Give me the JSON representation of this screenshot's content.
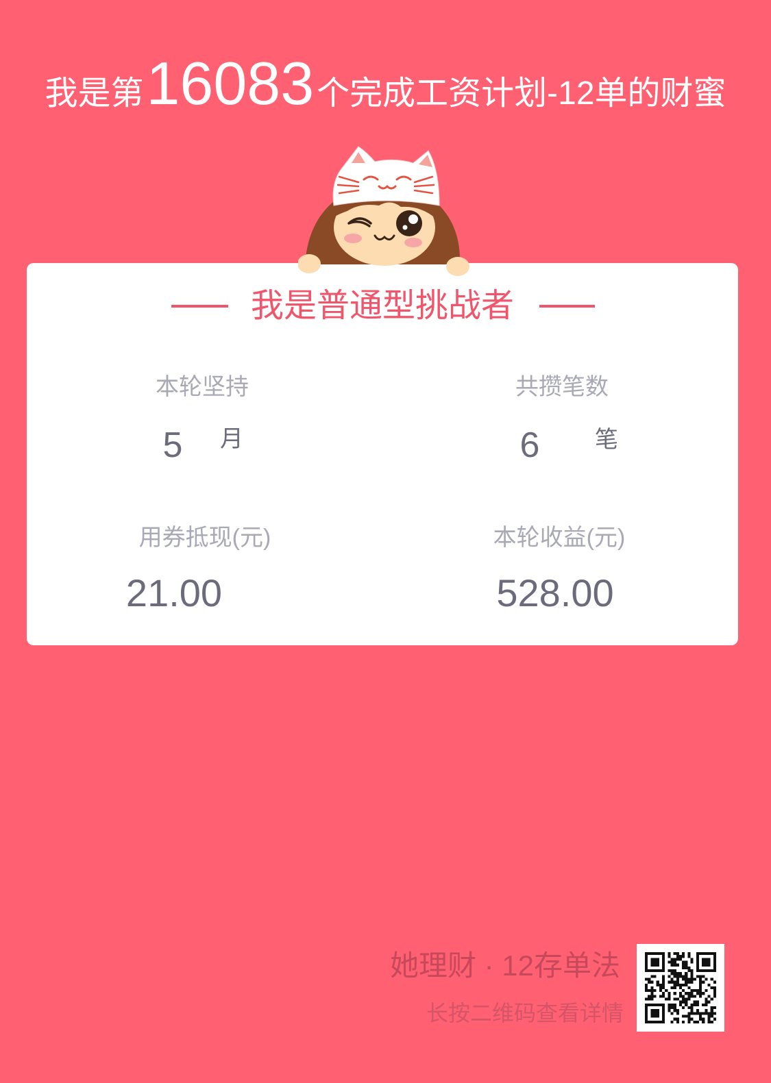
{
  "header": {
    "prefix": "我是第",
    "rank": "16083",
    "suffix": "个完成工资计划-12单的财蜜"
  },
  "card": {
    "title": "我是普通型挑战者",
    "stats": [
      {
        "label": "本轮坚持",
        "value": "5",
        "unit": "月"
      },
      {
        "label": "共攒笔数",
        "value": "6",
        "unit": "笔"
      },
      {
        "label": "用券抵现(元)",
        "value": "21.00"
      },
      {
        "label": "本轮收益(元)",
        "value": "528.00"
      }
    ]
  },
  "footer": {
    "brand": "她理财 · 12存单法",
    "hint": "长按二维码查看详情"
  },
  "icons": {
    "mascot": "cat-hat-girl-mascot-icon",
    "qr": "qr-code-icon"
  },
  "colors": {
    "background": "#FF6173",
    "card": "#FFFFFF",
    "accent": "#F0566B",
    "label": "#A9A9B5",
    "value": "#6B6B7B",
    "brand": "#C8485B"
  }
}
